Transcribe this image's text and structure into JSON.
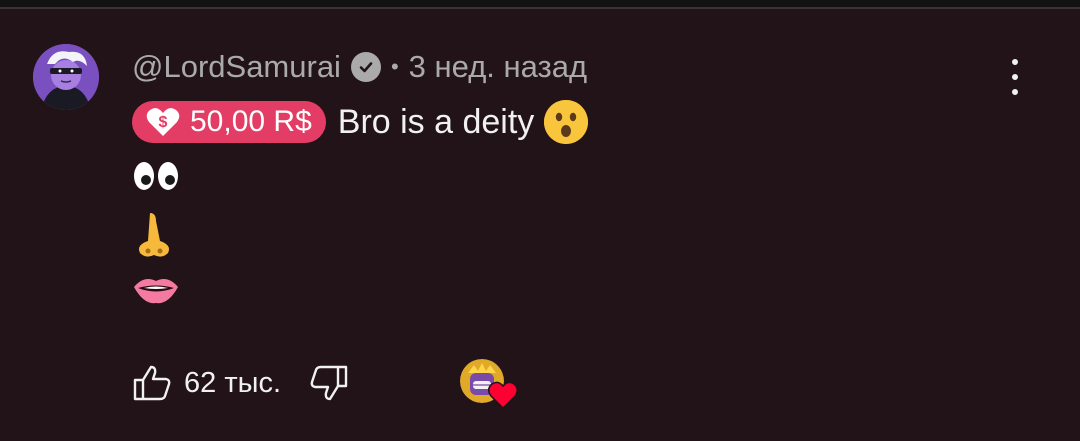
{
  "comment": {
    "author": "@LordSamurai",
    "separator": "•",
    "time_ago": "3 нед. назад",
    "thanks_amount": "50,00 R$",
    "text": "Bro is a deity",
    "emoji_lines": [
      "👀",
      "👃",
      "👄"
    ],
    "like_count": "62 тыс."
  },
  "icons": {
    "avatar": "user-avatar",
    "verified": "verified-check-icon",
    "menu": "more-vertical-icon",
    "thanks": "heart-dollar-icon",
    "emoji": "astonished-face",
    "like": "thumb-up-icon",
    "dislike": "thumb-down-icon",
    "creator_heart": "creator-heart-icon"
  },
  "colors": {
    "background": "#211317",
    "thanks_chip": "#e43d65",
    "secondary_text": "#aaaaaa",
    "heart": "#ff0033"
  }
}
